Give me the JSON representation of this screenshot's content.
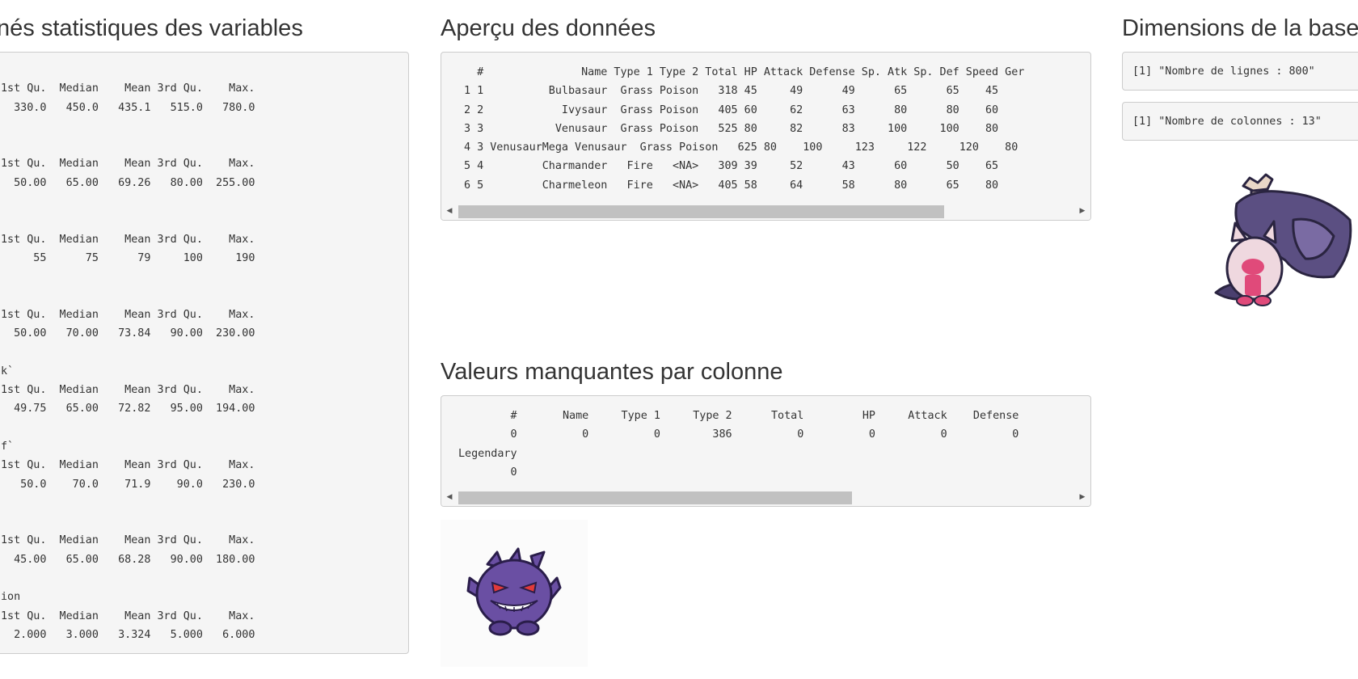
{
  "summary_section": {
    "title": "nés statistiques des variables",
    "output": "\n1st Qu.  Median    Mean 3rd Qu.    Max.\n  330.0   450.0   435.1   515.0   780.0\n\n\n1st Qu.  Median    Mean 3rd Qu.    Max.\n  50.00   65.00   69.26   80.00  255.00\n\n\n1st Qu.  Median    Mean 3rd Qu.    Max.\n     55      75      79     100     190\n\n\n1st Qu.  Median    Mean 3rd Qu.    Max.\n  50.00   70.00   73.84   90.00  230.00\n\nk`\n1st Qu.  Median    Mean 3rd Qu.    Max.\n  49.75   65.00   72.82   95.00  194.00\n\nf`\n1st Qu.  Median    Mean 3rd Qu.    Max.\n   50.0    70.0    71.9    90.0   230.0\n\n\n1st Qu.  Median    Mean 3rd Qu.    Max.\n  45.00   65.00   68.28   90.00  180.00\n\nion\n1st Qu.  Median    Mean 3rd Qu.    Max.\n  2.000   3.000   3.324   5.000   6.000"
  },
  "preview_section": {
    "title": "Aperçu des données",
    "output": "  #               Name Type 1 Type 2 Total HP Attack Defense Sp. Atk Sp. Def Speed Ger\n1 1          Bulbasaur  Grass Poison   318 45     49      49      65      65    45\n2 2            Ivysaur  Grass Poison   405 60     62      63      80      80    60\n3 3           Venusaur  Grass Poison   525 80     82      83     100     100    80\n4 3 VenusaurMega Venusaur  Grass Poison   625 80    100     123     122     120    80\n5 4         Charmander   Fire   <NA>   309 39     52      43      60      50    65\n6 5         Charmeleon   Fire   <NA>   405 58     64      58      80      65    80"
  },
  "missing_section": {
    "title": "Valeurs manquantes par colonne",
    "output": "        #       Name     Type 1     Type 2      Total         HP     Attack    Defense\n        0          0          0        386          0          0          0          0\nLegendary\n        0"
  },
  "dimensions_section": {
    "title": "Dimensions de la base",
    "rows_output": "[1] \"Nombre de lignes : 800\"",
    "cols_output": "[1] \"Nombre de colonnes : 13\""
  },
  "scrollbar_arrows": {
    "left": "◀",
    "right": "▶"
  },
  "scroll_positions": {
    "preview_thumb_fraction": 0.79,
    "missing_thumb_fraction": 0.64
  },
  "colors": {
    "panel_bg": "#f5f5f5",
    "panel_border": "#cccccc",
    "text": "#333333",
    "scroll_thumb": "#c1c1c1",
    "gengar_body": "#6a4fa3",
    "gengar_eye": "#e23a3a",
    "tinkaton_body": "#efd8df",
    "tinkaton_hammer": "#5b4f82",
    "tinkaton_accent": "#e04a7a"
  },
  "icons": {
    "gengar": "gengar-sprite-icon",
    "tinkaton": "tinkaton-sprite-icon"
  }
}
